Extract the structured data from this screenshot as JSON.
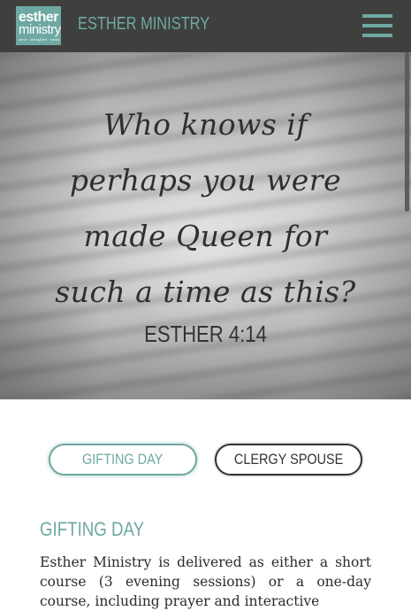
{
  "header": {
    "logo": {
      "line1": "esther",
      "line2": "ministry",
      "tagline": "serve · strengthen · sustain"
    },
    "brand": "ESTHER MINISTRY",
    "menu_icon": "hamburger-icon"
  },
  "hero": {
    "quote": "Who knows if perhaps you were made Queen for such a time as this?",
    "reference": "ESTHER 4:14"
  },
  "tabs": [
    {
      "label": "GIFTING DAY",
      "active": true
    },
    {
      "label": "CLERGY SPOUSE",
      "active": false
    }
  ],
  "section": {
    "title": "GIFTING DAY",
    "body": "Esther Ministry is delivered as either a short course (3 evening sessions) or a one-day course, including prayer and interactive"
  },
  "colors": {
    "accent": "#6fa8a2",
    "header_bg": "#3f403e",
    "text": "#2b2b2b"
  }
}
